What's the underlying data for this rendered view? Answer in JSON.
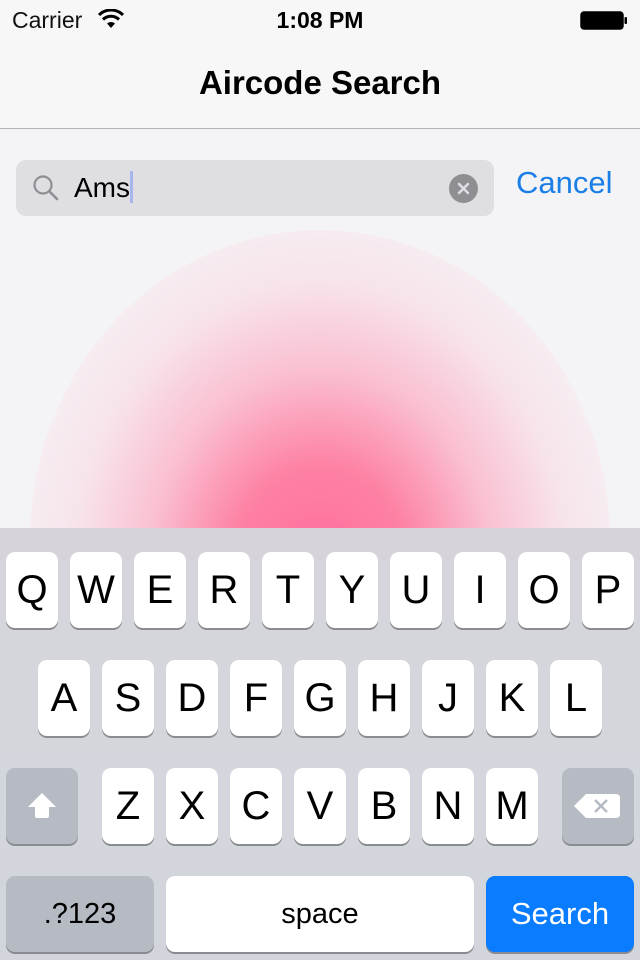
{
  "status_bar": {
    "carrier": "Carrier",
    "time": "1:08 PM",
    "wifi_icon": "wifi-icon",
    "battery_icon": "battery-full-icon"
  },
  "nav_bar": {
    "title": "Aircode Search"
  },
  "search": {
    "value": "Ams",
    "search_icon": "search-icon",
    "clear_icon": "clear-icon",
    "cancel_label": "Cancel"
  },
  "keyboard": {
    "row1": [
      "Q",
      "W",
      "E",
      "R",
      "T",
      "Y",
      "U",
      "I",
      "O",
      "P"
    ],
    "row2": [
      "A",
      "S",
      "D",
      "F",
      "G",
      "H",
      "J",
      "K",
      "L"
    ],
    "row3": [
      "Z",
      "X",
      "C",
      "V",
      "B",
      "N",
      "M"
    ],
    "shift_icon": "shift-icon",
    "delete_icon": "delete-icon",
    "numbers_label": ".?123",
    "space_label": "space",
    "search_label": "Search"
  },
  "colors": {
    "accent": "#1a7fe6",
    "search_key": "#0a7cff",
    "func_key": "#b5bac3",
    "keyboard_bg": "#d2d5dc"
  }
}
